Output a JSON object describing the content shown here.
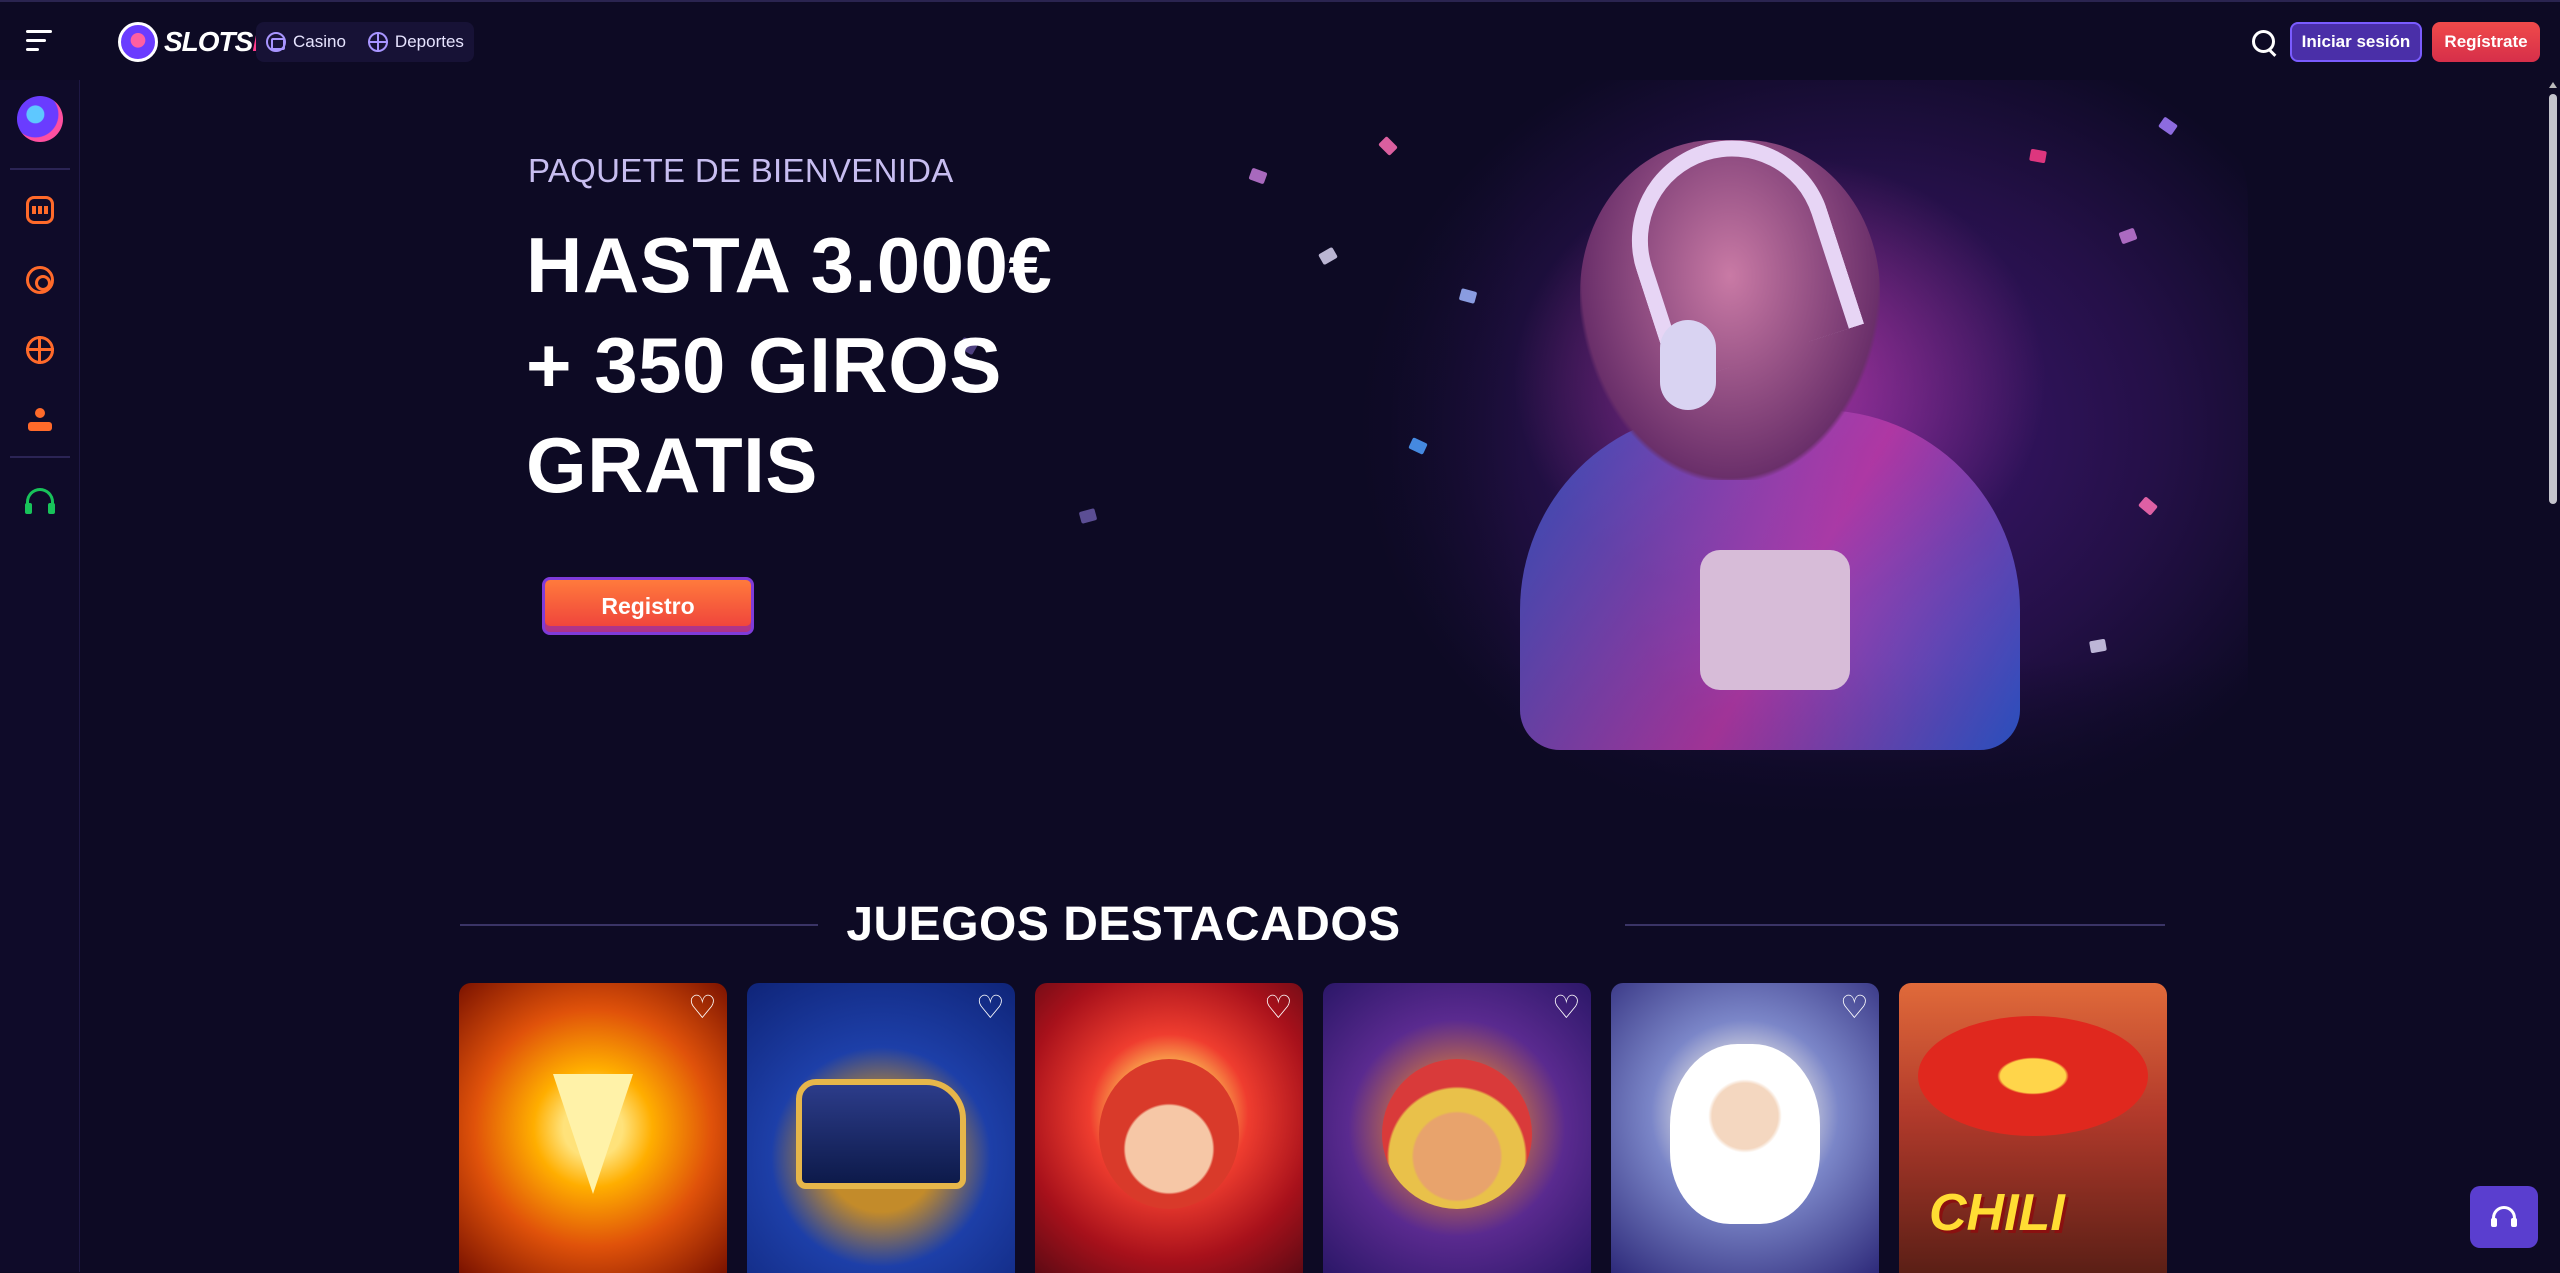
{
  "header": {
    "logo_text_a": "SLOTS",
    "logo_text_b": "DJ",
    "nav": [
      {
        "label": "Casino",
        "icon": "casino-icon"
      },
      {
        "label": "Deportes",
        "icon": "sports-ball-icon"
      }
    ],
    "login_label": "Iniciar sesión",
    "register_label": "Regístrate"
  },
  "sidebar": {
    "items": [
      {
        "icon": "slots-icon",
        "color": "#ff6a2a"
      },
      {
        "icon": "roulette-icon",
        "color": "#ff6a2a"
      },
      {
        "icon": "sports-ball-icon",
        "color": "#ff6a2a"
      },
      {
        "icon": "joystick-icon",
        "color": "#ff6a2a"
      },
      {
        "icon": "headset-icon",
        "color": "#18c35a"
      }
    ]
  },
  "hero": {
    "kicker": "PAQUETE DE BIENVENIDA",
    "title_line1": "HASTA 3.000€",
    "title_line2": "+ 350 GIROS",
    "title_line3": "GRATIS",
    "cta_label": "Registro"
  },
  "featured": {
    "title": "JUEGOS DESTACADOS",
    "games": [
      {
        "art": "lightning-gem"
      },
      {
        "art": "golden-train"
      },
      {
        "art": "jester"
      },
      {
        "art": "mexican-man"
      },
      {
        "art": "zeus"
      },
      {
        "art": "chili-amigos",
        "text": "CHILI"
      }
    ]
  },
  "colors": {
    "background": "#0d0a24",
    "accent_purple": "#4a2fa8",
    "accent_red": "#e23e45",
    "sidebar_icon": "#ff6a2a",
    "support_icon": "#18c35a"
  }
}
